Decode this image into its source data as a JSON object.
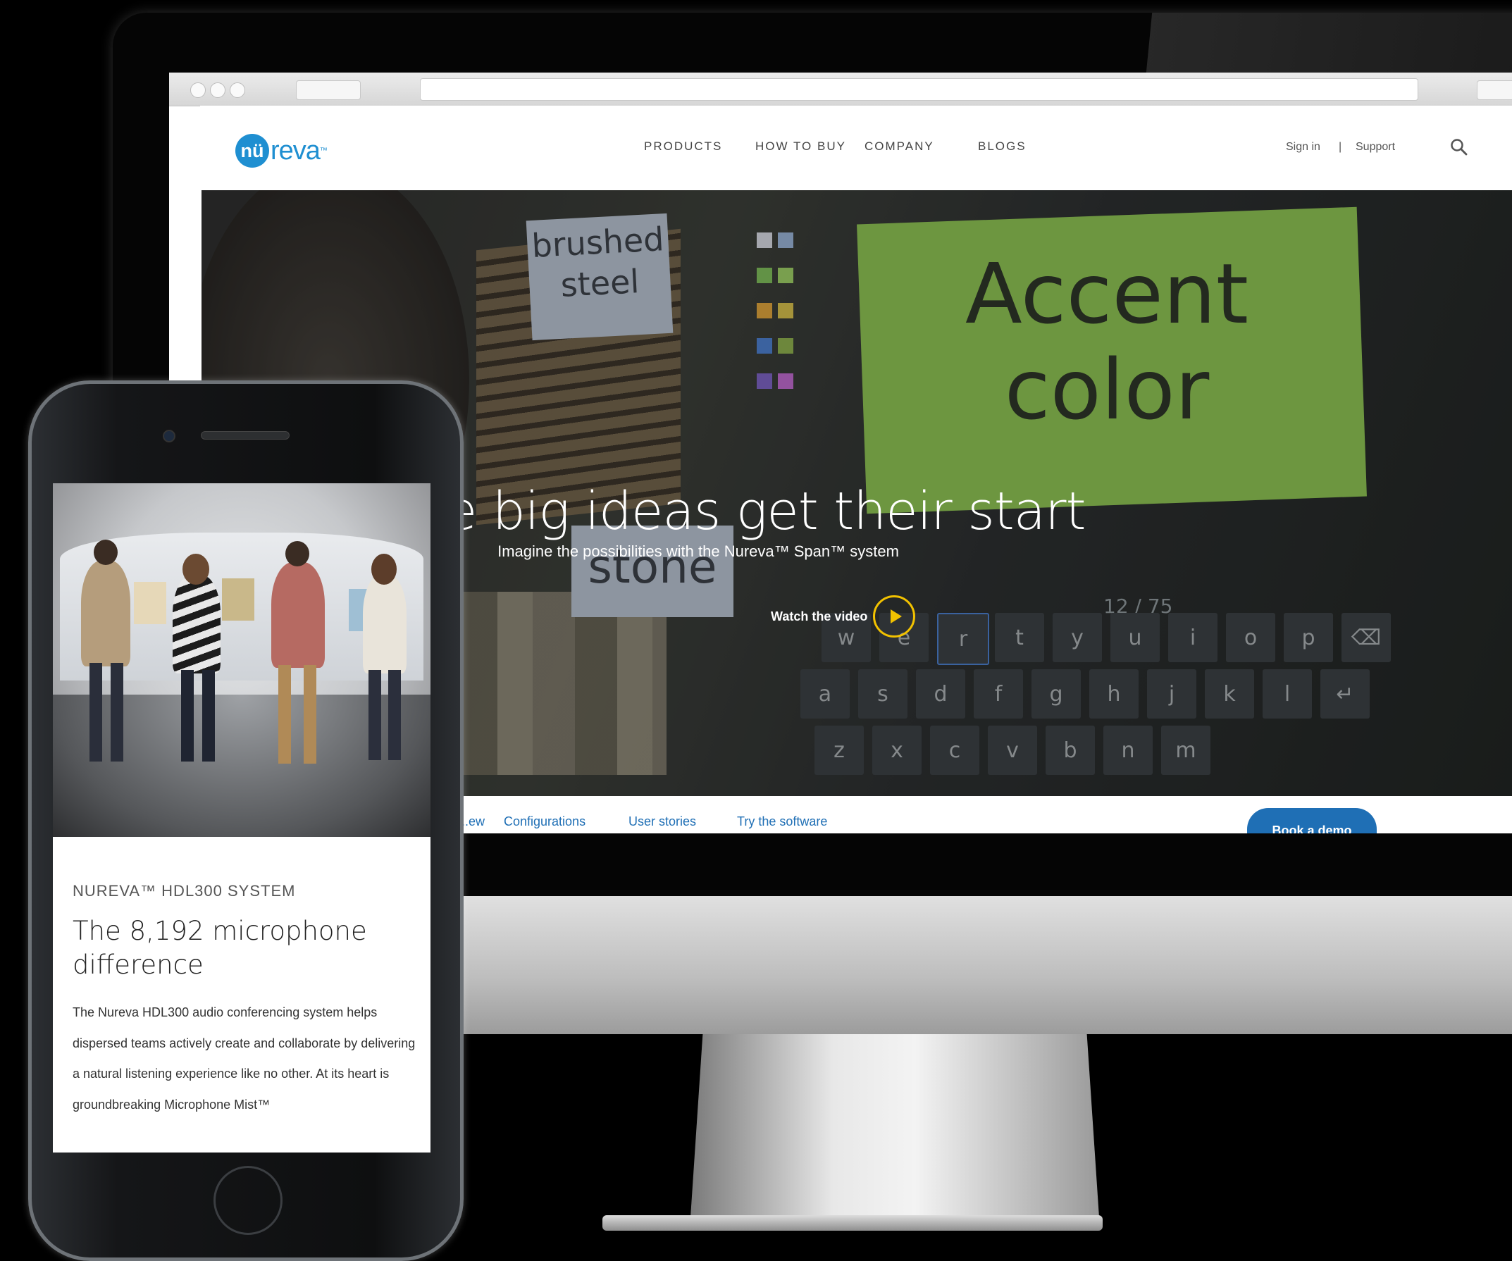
{
  "site": {
    "logo_text": "reva",
    "logo_badge": "nü",
    "logo_tm": "™",
    "nav": [
      "PRODUCTS",
      "HOW TO BUY",
      "COMPANY",
      "BLOGS"
    ],
    "sign_in": "Sign in",
    "separator": "|",
    "support": "Support",
    "search_icon": "search-icon"
  },
  "hero": {
    "card_brushed": "brushed steel",
    "card_stone": "stone",
    "green_card": "Accent color",
    "counter": "12 / 75",
    "keyboard_rows": [
      [
        "w",
        "e",
        "r",
        "t",
        "y",
        "u",
        "i",
        "o",
        "p",
        "⌫"
      ],
      [
        "a",
        "s",
        "d",
        "f",
        "g",
        "h",
        "j",
        "k",
        "l",
        "↵"
      ],
      [
        "z",
        "x",
        "c",
        "v",
        "b",
        "n",
        "m"
      ]
    ],
    "title": "Where big ideas get their start",
    "subtitle": "Imagine the possibilities with the Nureva™ Span™ system",
    "watch_label": "Watch the video"
  },
  "subnav": [
    "...ew",
    "Configurations",
    "User stories",
    "Try the software"
  ],
  "demo_button": "Book a demo",
  "phone": {
    "eyebrow": "NUREVA™ HDL300 SYSTEM",
    "title": "The 8,192 microphone difference",
    "body": "The Nureva HDL300 audio conferencing system helps dispersed teams actively create and collaborate by delivering a natural listening experience like no other. At its heart is groundbreaking Microphone Mist™"
  },
  "colors": {
    "brand_blue": "#1f8fd1",
    "play_yellow": "#f2c200",
    "accent_green": "#8ec452",
    "button_blue": "#1f6fb5"
  }
}
